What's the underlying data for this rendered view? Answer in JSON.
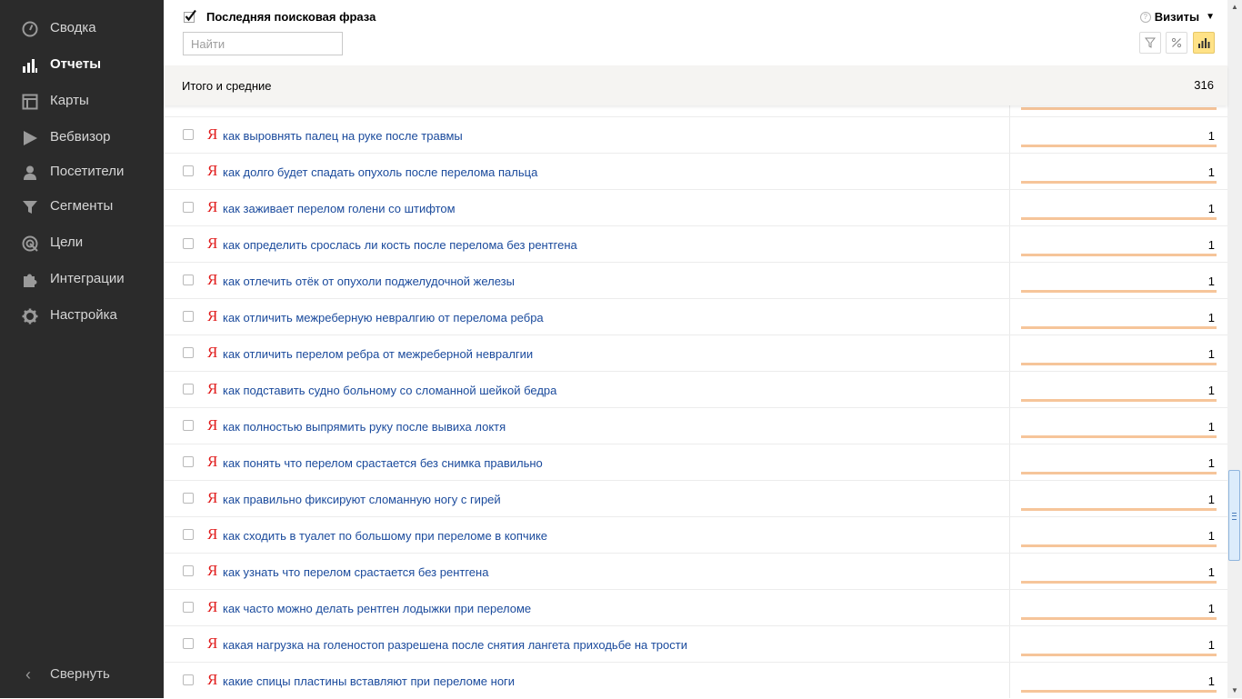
{
  "sidebar": {
    "items": [
      {
        "label": "Сводка",
        "icon": "dashboard-gauge-icon",
        "active": false
      },
      {
        "label": "Отчеты",
        "icon": "bar-chart-icon",
        "active": true
      },
      {
        "label": "Карты",
        "icon": "map-grid-icon",
        "active": false
      },
      {
        "label": "Вебвизор",
        "icon": "play-icon",
        "active": false
      },
      {
        "label": "Посетители",
        "icon": "person-icon",
        "active": false
      },
      {
        "label": "Сегменты",
        "icon": "funnel-icon",
        "active": false
      },
      {
        "label": "Цели",
        "icon": "target-icon",
        "active": false
      },
      {
        "label": "Интеграции",
        "icon": "puzzle-icon",
        "active": false
      },
      {
        "label": "Настройка",
        "icon": "gear-icon",
        "active": false
      }
    ],
    "collapse_label": "Свернуть",
    "collapse_icon": "‹"
  },
  "table": {
    "dimension_title": "Последняя поисковая фраза",
    "search_placeholder": "Найти",
    "metric_label": "Визиты",
    "help_symbol": "?",
    "dropdown_symbol": "▼",
    "totals_label": "Итого и средние",
    "totals_value": "316",
    "search_engine_mark": "Я",
    "rows": [
      {
        "phrase": "как выровнять палец на руке после травмы",
        "value": "1"
      },
      {
        "phrase": "как долго будет спадать опухоль после перелома пальца",
        "value": "1"
      },
      {
        "phrase": "как заживает перелом голени со штифтом",
        "value": "1"
      },
      {
        "phrase": "как определить срослась ли кость после перелома без рентгена",
        "value": "1"
      },
      {
        "phrase": "как отлечить отёк от опухоли поджелудочной железы",
        "value": "1"
      },
      {
        "phrase": "как отличить межреберную невралгию от перелома ребра",
        "value": "1"
      },
      {
        "phrase": "как отличить перелом ребра от межреберной невралгии",
        "value": "1"
      },
      {
        "phrase": "как подставить судно больному со сломанной шейкой бедра",
        "value": "1"
      },
      {
        "phrase": "как полностью выпрямить руку после вывиха локтя",
        "value": "1"
      },
      {
        "phrase": "как понять что перелом срастается без снимка правильно",
        "value": "1"
      },
      {
        "phrase": "как правильно фиксируют сломанную ногу с гирей",
        "value": "1"
      },
      {
        "phrase": "как сходить в туалет по большому при переломе в копчике",
        "value": "1"
      },
      {
        "phrase": "как узнать что перелом срастается без рентгена",
        "value": "1"
      },
      {
        "phrase": "как часто можно делать рентген лодыжки при переломе",
        "value": "1"
      },
      {
        "phrase": "какая нагрузка на голеностоп разрешена после снятия лангета приходьбе на трости",
        "value": "1"
      },
      {
        "phrase": "какие спицы пластины вставляют при переломе ноги",
        "value": "1"
      }
    ]
  },
  "colors": {
    "sidebar_bg": "#2b2b2b",
    "link": "#1a4a9c",
    "bar": "#f6c59a",
    "yandex_red": "#e01a1a",
    "active_tool": "#ffe287"
  }
}
